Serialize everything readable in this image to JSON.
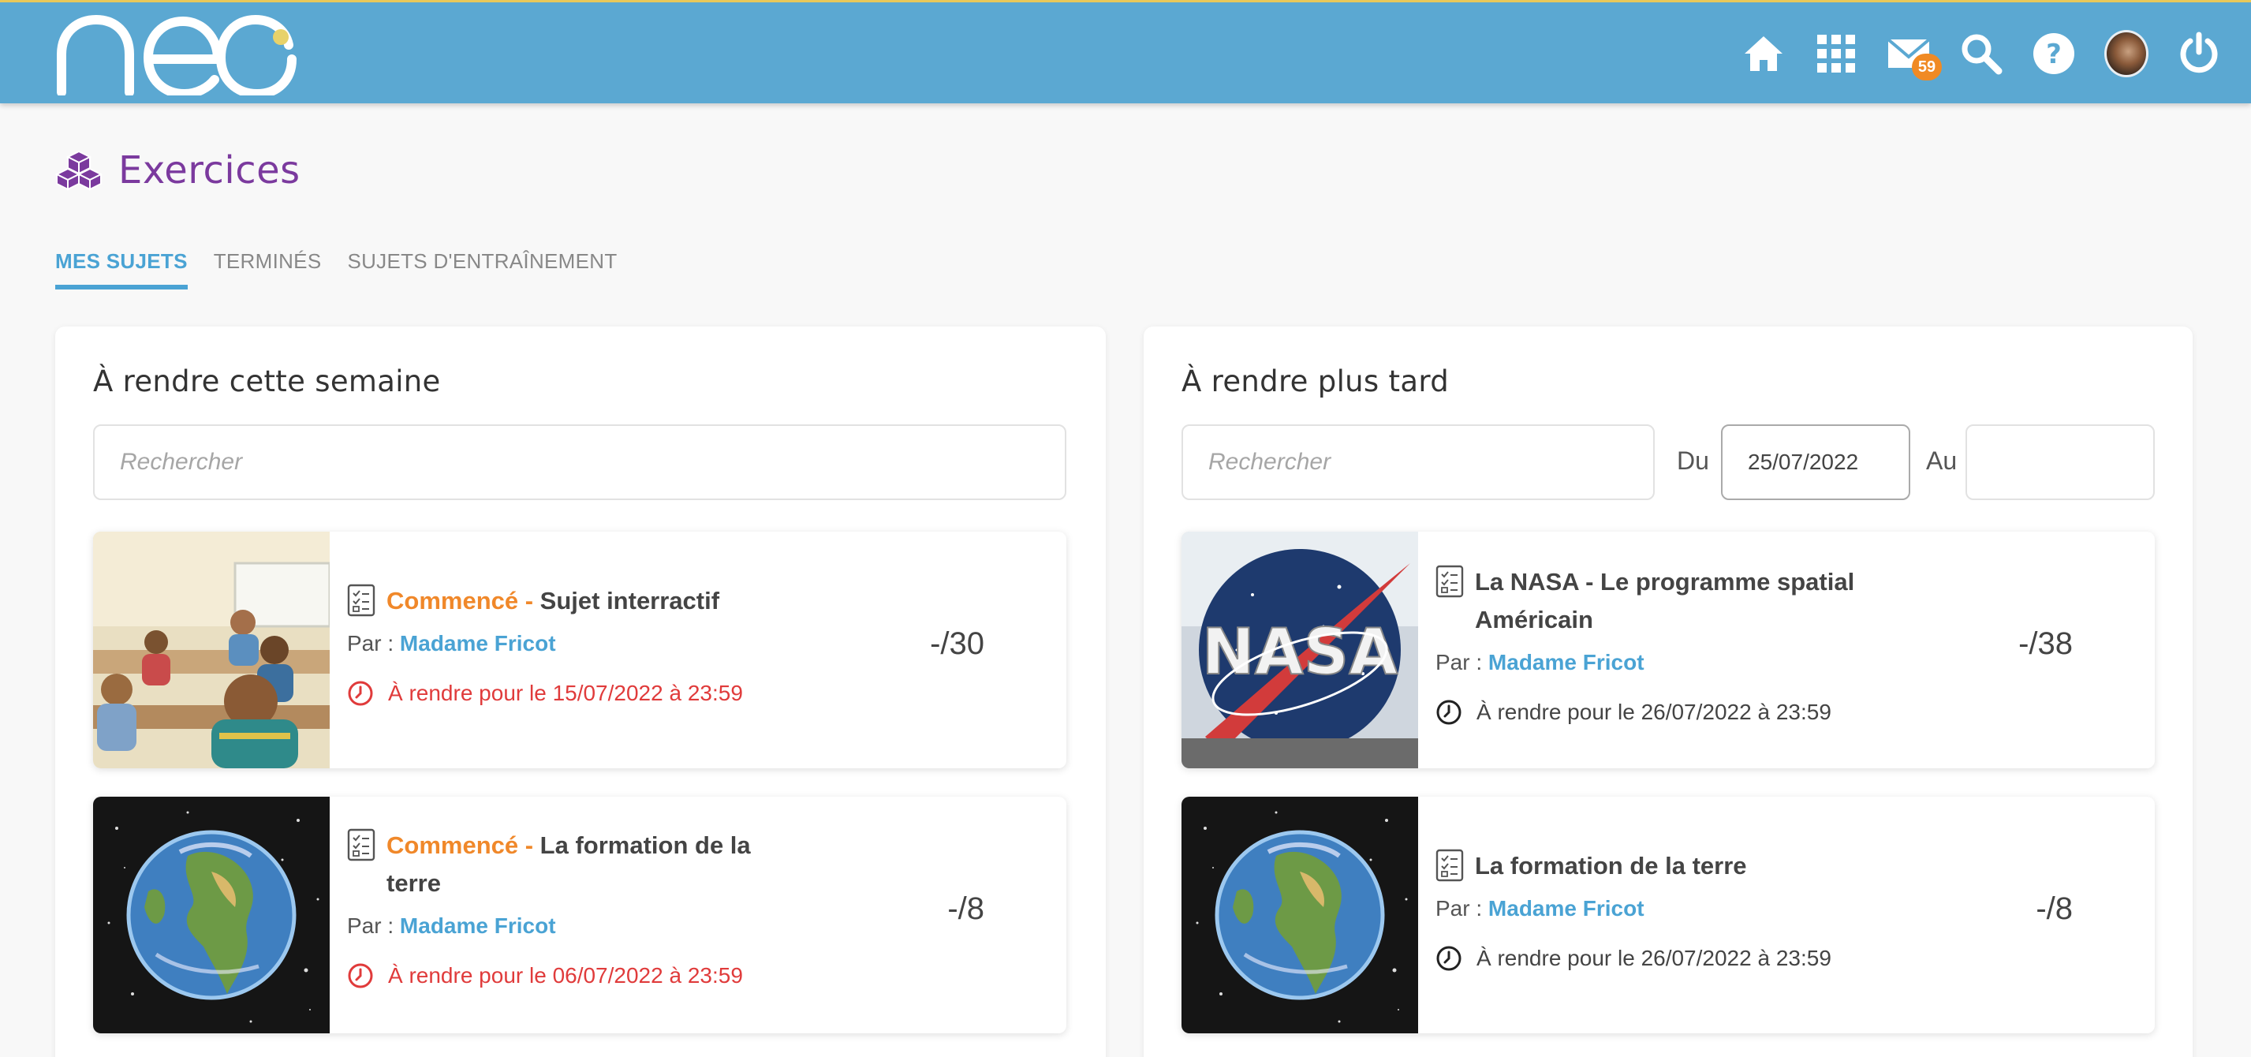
{
  "header": {
    "logo_text": "neo",
    "mail_badge": "59",
    "icons": [
      "home-icon",
      "apps-grid-icon",
      "mail-icon",
      "search-icon",
      "help-icon",
      "avatar",
      "power-icon"
    ],
    "bg_color": "#5ba8d2"
  },
  "page": {
    "title": "Exercices",
    "title_color": "#7b3a9e"
  },
  "tabs": [
    {
      "label": "MES SUJETS",
      "active": true
    },
    {
      "label": "TERMINÉS",
      "active": false
    },
    {
      "label": "SUJETS D'ENTRAÎNEMENT",
      "active": false
    }
  ],
  "left_panel": {
    "title": "À rendre cette semaine",
    "search_placeholder": "Rechercher",
    "cards": [
      {
        "status": "Commencé - ",
        "title": "Sujet interractif",
        "by_label": "Par : ",
        "teacher": "Madame Fricot",
        "due": "À rendre pour le 15/07/2022 à 23:59",
        "score": "-/30",
        "image": "classroom-photo"
      },
      {
        "status": "Commencé - ",
        "title": "La formation de la terre",
        "by_label": "Par : ",
        "teacher": "Madame Fricot",
        "due": "À rendre pour le 06/07/2022 à 23:59",
        "score": "-/8",
        "image": "earth-illustration"
      }
    ]
  },
  "right_panel": {
    "title": "À rendre plus tard",
    "search_placeholder": "Rechercher",
    "from_label": "Du",
    "from_value": "25/07/2022",
    "to_label": "Au",
    "to_value": "",
    "cards": [
      {
        "title": "La NASA - Le programme spatial Américain",
        "by_label": "Par : ",
        "teacher": "Madame Fricot",
        "due": "À rendre pour le 26/07/2022 à 23:59",
        "score": "-/38",
        "image": "nasa-logo"
      },
      {
        "title": "La formation de la terre",
        "by_label": "Par : ",
        "teacher": "Madame Fricot",
        "due": "À rendre pour le 26/07/2022 à 23:59",
        "score": "-/8",
        "image": "earth-illustration"
      }
    ]
  },
  "colors": {
    "accent": "#4aa3d4",
    "status_orange": "#f0882a",
    "late_red": "#e03b3b"
  }
}
